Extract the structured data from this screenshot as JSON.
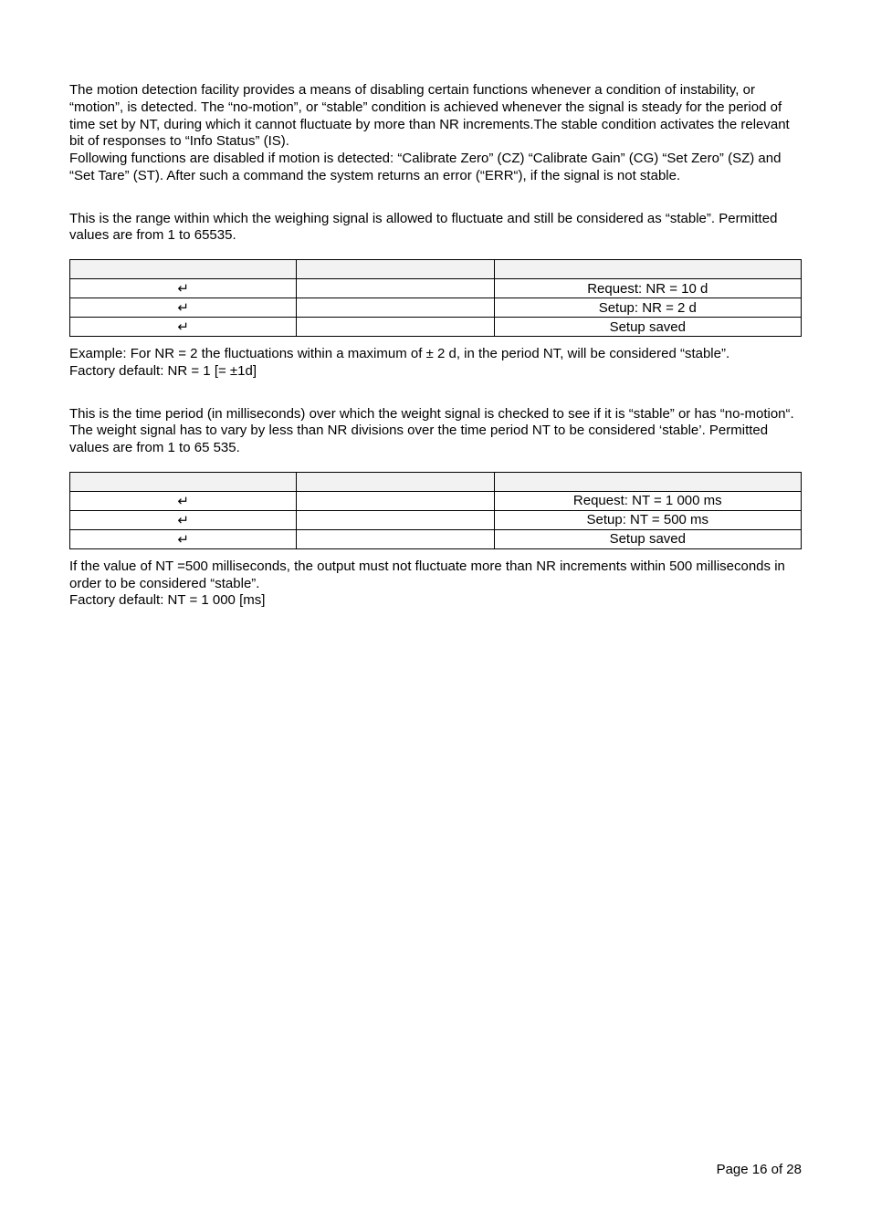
{
  "intro_p1": "The motion detection facility provides a means of disabling certain functions whenever a condition of instability, or “motion”, is detected. The “no-motion”, or “stable” condition is achieved whenever the signal is steady for the period of time set by NT, during which it cannot fluctuate by more than NR increments.The stable condition activates the relevant bit of responses to “Info Status” (IS).",
  "intro_p2": "Following functions are disabled if motion is detected: “Calibrate Zero” (CZ) “Calibrate Gain” (CG) “Set Zero” (SZ) and “Set Tare” (ST). After such a command the system returns an error (“ERR“), if the signal is not stable.",
  "nr_intro": "This is the range within which the weighing signal is allowed to fluctuate and still be considered as “stable”. Permitted values are from 1 to 65535.",
  "table_nr": {
    "rows": [
      {
        "c1_entered": "",
        "c2": "",
        "c3": ""
      },
      {
        "c1_entered": "↵",
        "c2": "",
        "c3": "Request: NR = 10 d"
      },
      {
        "c1_entered": "↵",
        "c2": "",
        "c3": "Setup: NR = 2 d"
      },
      {
        "c1_entered": "↵",
        "c2": "",
        "c3": "Setup saved"
      }
    ]
  },
  "nr_example_l1": "Example: For NR = 2  the fluctuations within a maximum of ± 2 d, in the period NT, will be considered “stable”.",
  "nr_example_l2": "Factory default: NR = 1 [= ±1d]",
  "nt_intro": "This is the time period (in milliseconds) over which the weight signal is checked to see if it is “stable” or has “no-motion“. The weight signal has to vary by less than NR divisions over the time period NT to be considered ‘stable’. Permitted values are from 1 to 65 535.",
  "table_nt": {
    "rows": [
      {
        "c1_entered": "",
        "c2": "",
        "c3": ""
      },
      {
        "c1_entered": "↵",
        "c2": "",
        "c3": "Request: NT = 1 000 ms"
      },
      {
        "c1_entered": "↵",
        "c2": "",
        "c3": "Setup: NT = 500 ms"
      },
      {
        "c1_entered": "↵",
        "c2": "",
        "c3": "Setup saved"
      }
    ]
  },
  "nt_outro_l1": "If the value of NT =500 milliseconds, the output must not fluctuate more than NR increments within 500 milliseconds in order to be considered “stable”.",
  "nt_outro_l2": "Factory default: NT = 1 000  [ms]",
  "footer": "Page 16 of 28"
}
